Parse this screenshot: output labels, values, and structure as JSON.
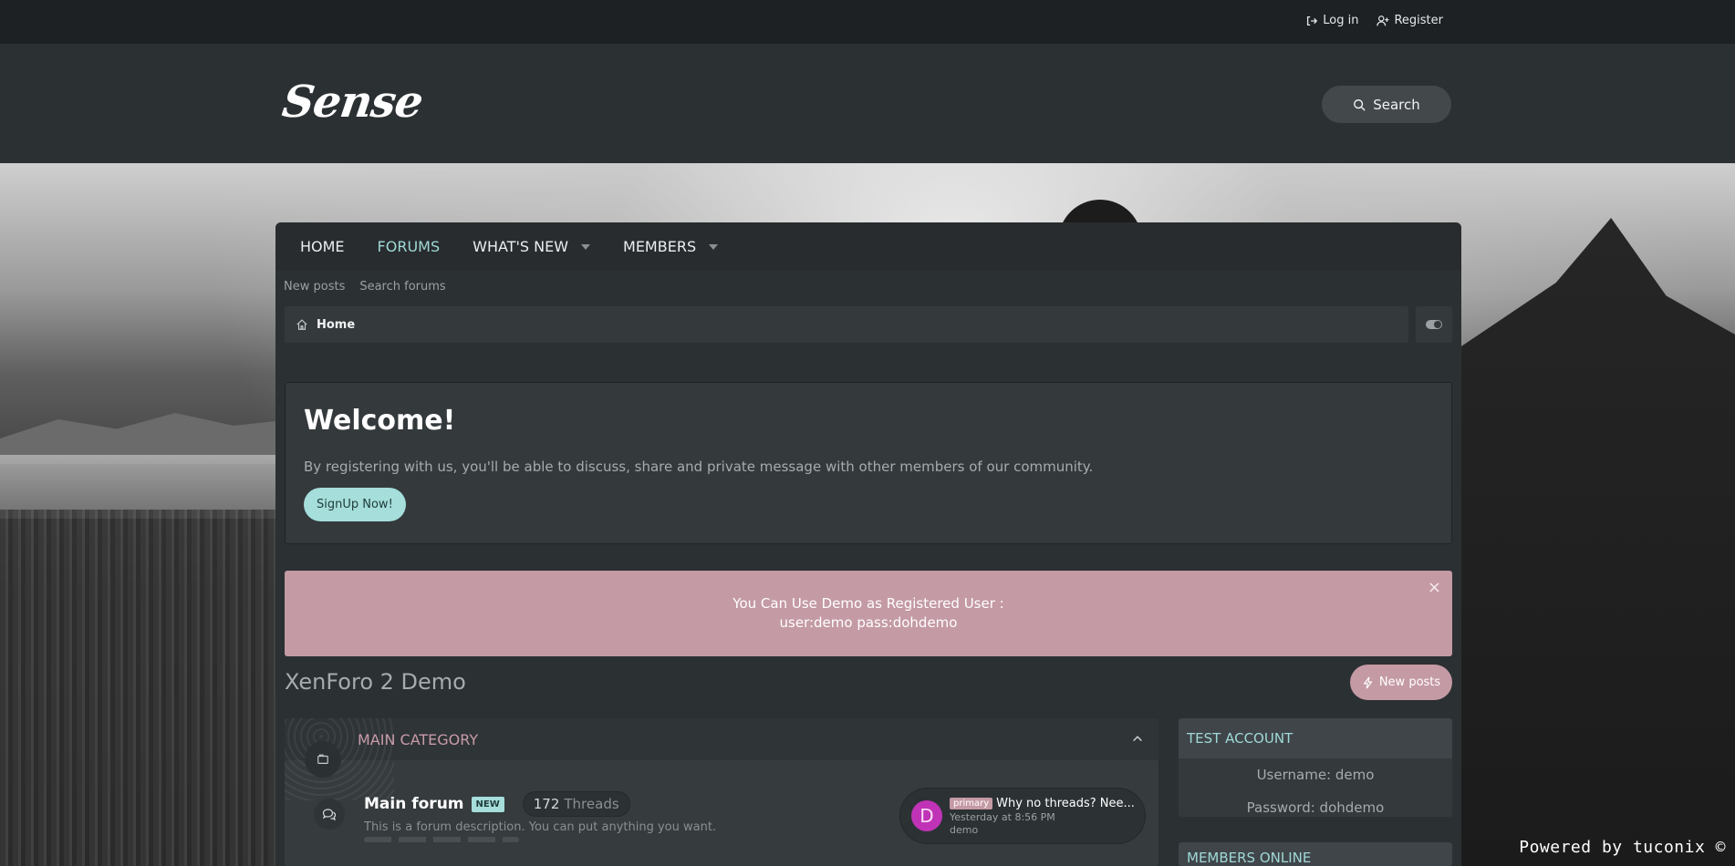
{
  "topbar": {
    "login_label": "Log in",
    "register_label": "Register"
  },
  "header": {
    "logo_text": "Sense",
    "search_label": "Search"
  },
  "nav": {
    "tabs": [
      {
        "label": "HOME"
      },
      {
        "label": "FORUMS"
      },
      {
        "label": "WHAT'S NEW"
      },
      {
        "label": "MEMBERS"
      }
    ],
    "subnav": [
      "New posts",
      "Search forums"
    ]
  },
  "breadcrumb": {
    "home_label": "Home"
  },
  "welcome": {
    "title": "Welcome!",
    "text": "By registering with us, you'll be able to discuss, share and private message with other members of our community.",
    "signup_label": "SignUp Now!"
  },
  "notice": {
    "line1": "You Can Use Demo as Registered User :",
    "line2": "user:demo pass:dohdemo",
    "close": "×"
  },
  "page": {
    "title": "XenForo 2 Demo",
    "new_posts_label": "New posts"
  },
  "category": {
    "title": "MAIN CATEGORY",
    "forum": {
      "name": "Main forum",
      "badge": "NEW",
      "threads_count": "172",
      "threads_label": "Threads",
      "description": "This is a forum description. You can put anything you want.",
      "latest": {
        "avatar_letter": "D",
        "prefix": "primary",
        "title": "Why no threads? Nee...",
        "time": "Yesterday at 8:56 PM",
        "user": "demo"
      }
    }
  },
  "sidebar": {
    "test_account": {
      "title": "TEST ACCOUNT",
      "username": "Username: demo",
      "password": "Password: dohdemo"
    },
    "members_online": {
      "title": "MEMBERS ONLINE"
    }
  },
  "footer": {
    "powered": "Powered by tuconix ©"
  },
  "colors": {
    "accent_teal": "#9fd9d6",
    "accent_pink": "#c49aa5",
    "avatar_magenta": "#c033b6"
  }
}
